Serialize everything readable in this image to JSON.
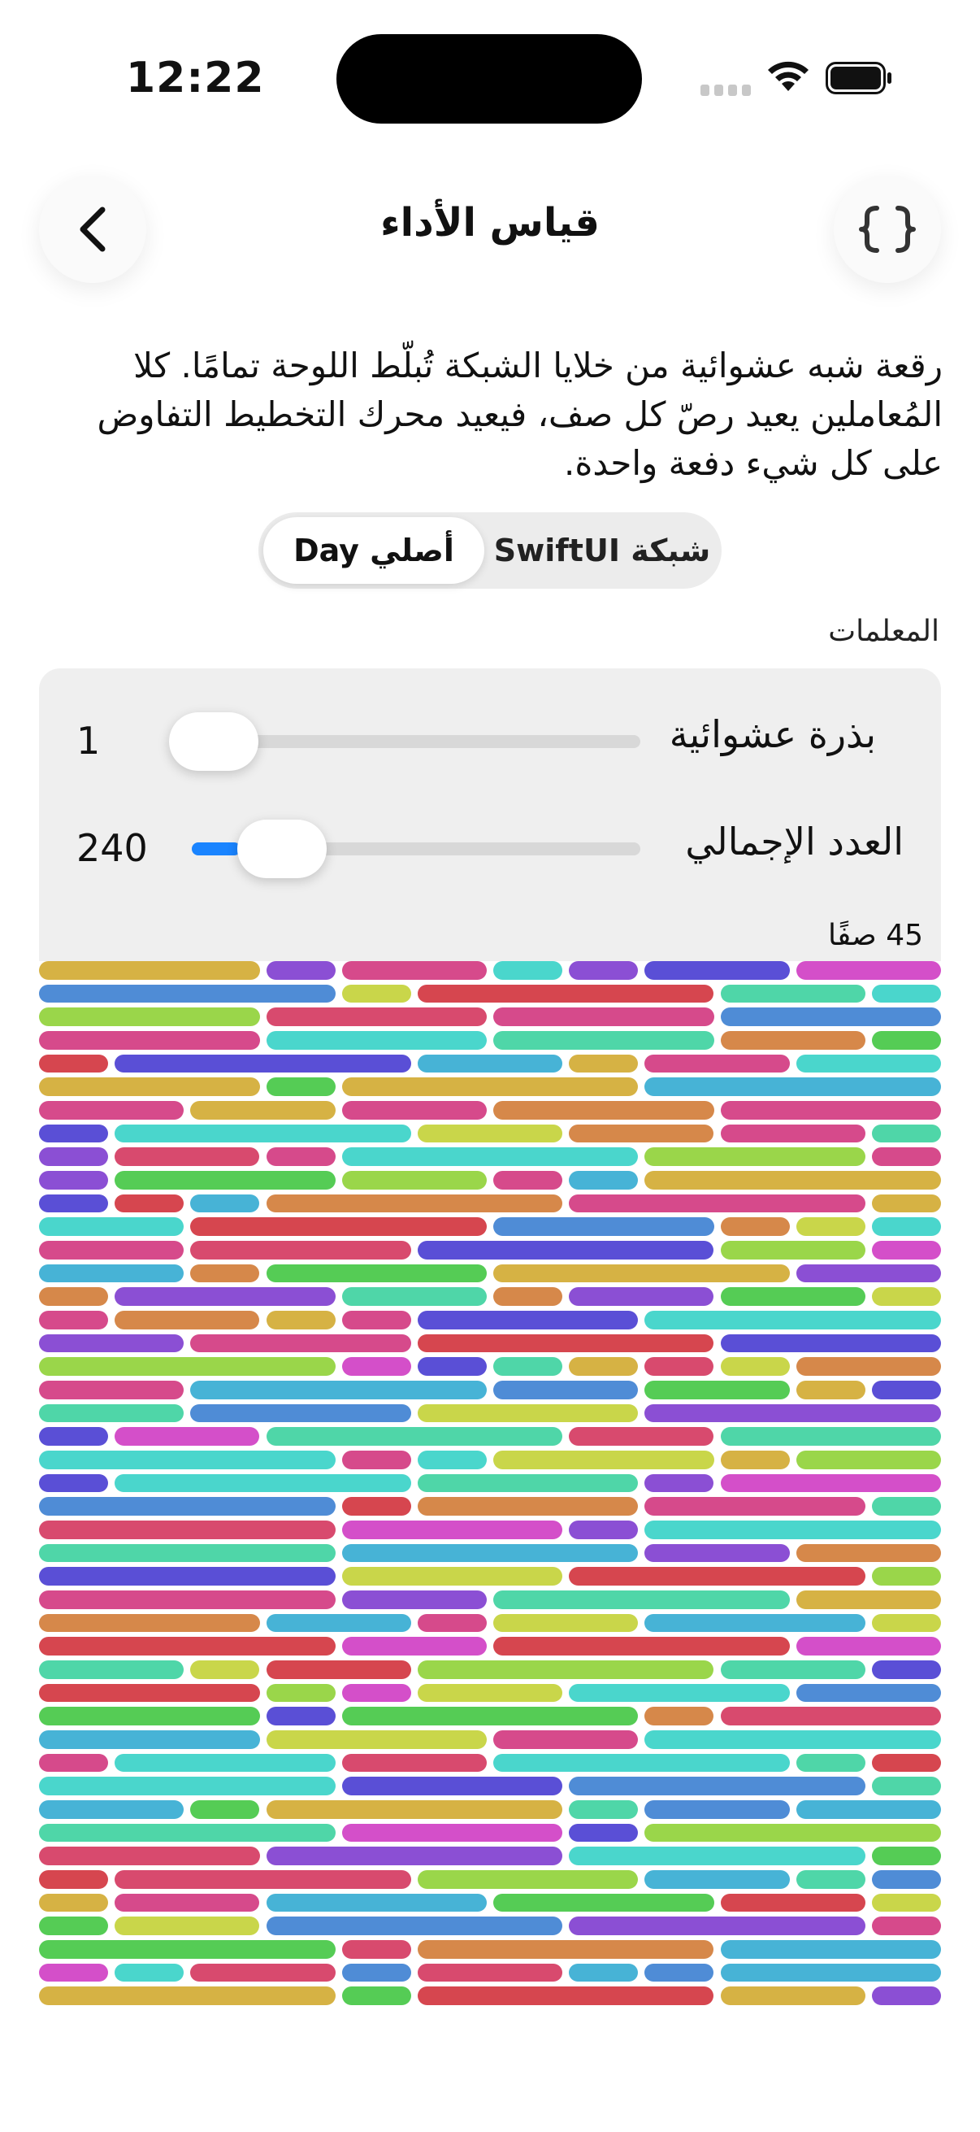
{
  "status_bar": {
    "time": "12:22"
  },
  "nav": {
    "title": "قياس الأداء",
    "back_icon": "chevron-left-icon",
    "code_icon": "curly-braces-icon"
  },
  "description": "رقعة شبه عشوائية من خلايا الشبكة تُبلّط اللوحة تمامًا. كلا المُعاملين يعيد رصّ كل صف، فيعيد محرك التخطيط التفاوض على كل شيء دفعة واحدة.",
  "segmented": {
    "options": [
      {
        "label": "أصلي Day",
        "selected": true
      },
      {
        "label": "شبكة SwiftUI",
        "selected": false
      }
    ]
  },
  "parameters": {
    "section_label": "المعلمات",
    "random_seed": {
      "label": "بذرة عشوائية",
      "value": "1",
      "fraction": 0.0
    },
    "total_count": {
      "label": "العدد الإجمالي",
      "value": "240",
      "fraction": 0.1
    }
  },
  "grid": {
    "row_count_label": "45 صفًا",
    "rows": 45
  },
  "colors": {
    "accent": "#1a84ff",
    "palette": [
      "#d84a6e",
      "#47b3d6",
      "#d6b244",
      "#8b4fd4",
      "#55cc55",
      "#d6464f",
      "#4f8cd6",
      "#c9d64a",
      "#d44fc9",
      "#4fd6a8",
      "#d6884a",
      "#5a4fd6",
      "#9ad64a",
      "#d64a8b",
      "#4ad6cc"
    ]
  }
}
